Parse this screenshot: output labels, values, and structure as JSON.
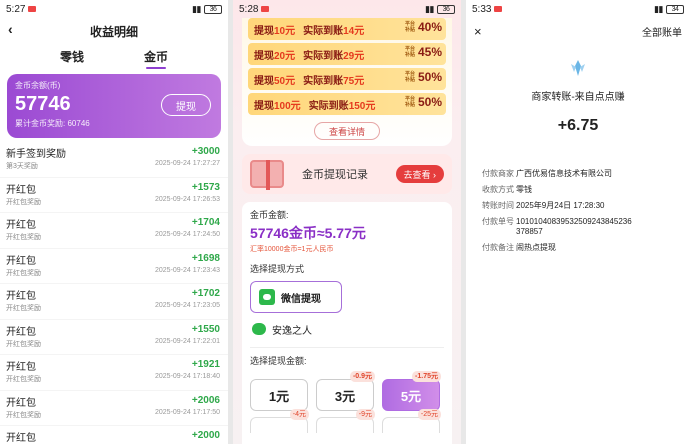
{
  "panel1": {
    "status": {
      "time": "5:27",
      "battery": "36"
    },
    "header": {
      "back": "‹",
      "title": "收益明细"
    },
    "tabs": [
      "零钱",
      "金币"
    ],
    "balance": {
      "label": "金币余额(币)",
      "value": "57746",
      "sub_label": "累计金币奖励:",
      "sub_value": "60746",
      "withdraw": "提现"
    },
    "rows": [
      {
        "title": "新手签到奖励",
        "sub": "第3天奖励",
        "amount": "+3000",
        "date": "2025-09-24 17:27:27"
      },
      {
        "title": "开红包",
        "sub": "开红包奖励",
        "amount": "+1573",
        "date": "2025-09-24 17:26:53"
      },
      {
        "title": "开红包",
        "sub": "开红包奖励",
        "amount": "+1704",
        "date": "2025-09-24 17:24:50"
      },
      {
        "title": "开红包",
        "sub": "开红包奖励",
        "amount": "+1698",
        "date": "2025-09-24 17:23:43"
      },
      {
        "title": "开红包",
        "sub": "开红包奖励",
        "amount": "+1702",
        "date": "2025-09-24 17:23:05"
      },
      {
        "title": "开红包",
        "sub": "开红包奖励",
        "amount": "+1550",
        "date": "2025-09-24 17:22:01"
      },
      {
        "title": "开红包",
        "sub": "开红包奖励",
        "amount": "+1921",
        "date": "2025-09-24 17:18:40"
      },
      {
        "title": "开红包",
        "sub": "开红包奖励",
        "amount": "+2006",
        "date": "2025-09-24 17:17:50"
      },
      {
        "title": "开红包",
        "sub": "",
        "amount": "+2000",
        "date": ""
      }
    ]
  },
  "panel2": {
    "status": {
      "time": "5:28",
      "battery": "36"
    },
    "rates": [
      {
        "a": "提现",
        "b": "10元",
        "c": "实际到账",
        "d": "14元",
        "tag": "平台补贴",
        "pct": "40%"
      },
      {
        "a": "提现",
        "b": "20元",
        "c": "实际到账",
        "d": "29元",
        "tag": "平台补贴",
        "pct": "45%"
      },
      {
        "a": "提现",
        "b": "50元",
        "c": "实际到账",
        "d": "75元",
        "tag": "平台补贴",
        "pct": "50%"
      },
      {
        "a": "提现",
        "b": "100元",
        "c": "实际到账",
        "d": "150元",
        "tag": "平台补贴",
        "pct": "50%"
      }
    ],
    "detail_button": "查看详情",
    "record": {
      "title": "金币提现记录",
      "button": "去查看 ›"
    },
    "coins": {
      "label": "金币金额:",
      "amount": "57746金币≈5.77元",
      "rate": "汇率10000金币=1元人民币",
      "method_label": "选择提现方式",
      "wechat": "微信提现",
      "user": "安逸之人",
      "amount_label": "选择提现金额:",
      "options": [
        {
          "label": "1元",
          "badge": ""
        },
        {
          "label": "3元",
          "badge": "-0.9元"
        },
        {
          "label": "5元",
          "badge": "-1.75元"
        }
      ],
      "options_row2": [
        {
          "badge": "-4元"
        },
        {
          "badge": "-9元"
        },
        {
          "badge": "-25元"
        }
      ]
    }
  },
  "panel3": {
    "status": {
      "time": "5:33",
      "battery": "34"
    },
    "header": {
      "close": "×",
      "title": "全部账单"
    },
    "merchant": "商家转账-来自点点赚",
    "amount": "+6.75",
    "info": [
      {
        "k": "付款商家",
        "v": "广西优易信息技术有限公司"
      },
      {
        "k": "收款方式",
        "v": "零钱"
      },
      {
        "k": "转账时间",
        "v": "2025年9月24日 17:28:30"
      },
      {
        "k": "付款单号",
        "v": "10101040839532509243845236378857"
      },
      {
        "k": "付款备注",
        "v": "闹热点提现"
      }
    ]
  },
  "colors": {
    "purple": "#9b4ad3",
    "green": "#2fa84a",
    "red": "#e53d3d",
    "gold": "#ffd77a"
  }
}
